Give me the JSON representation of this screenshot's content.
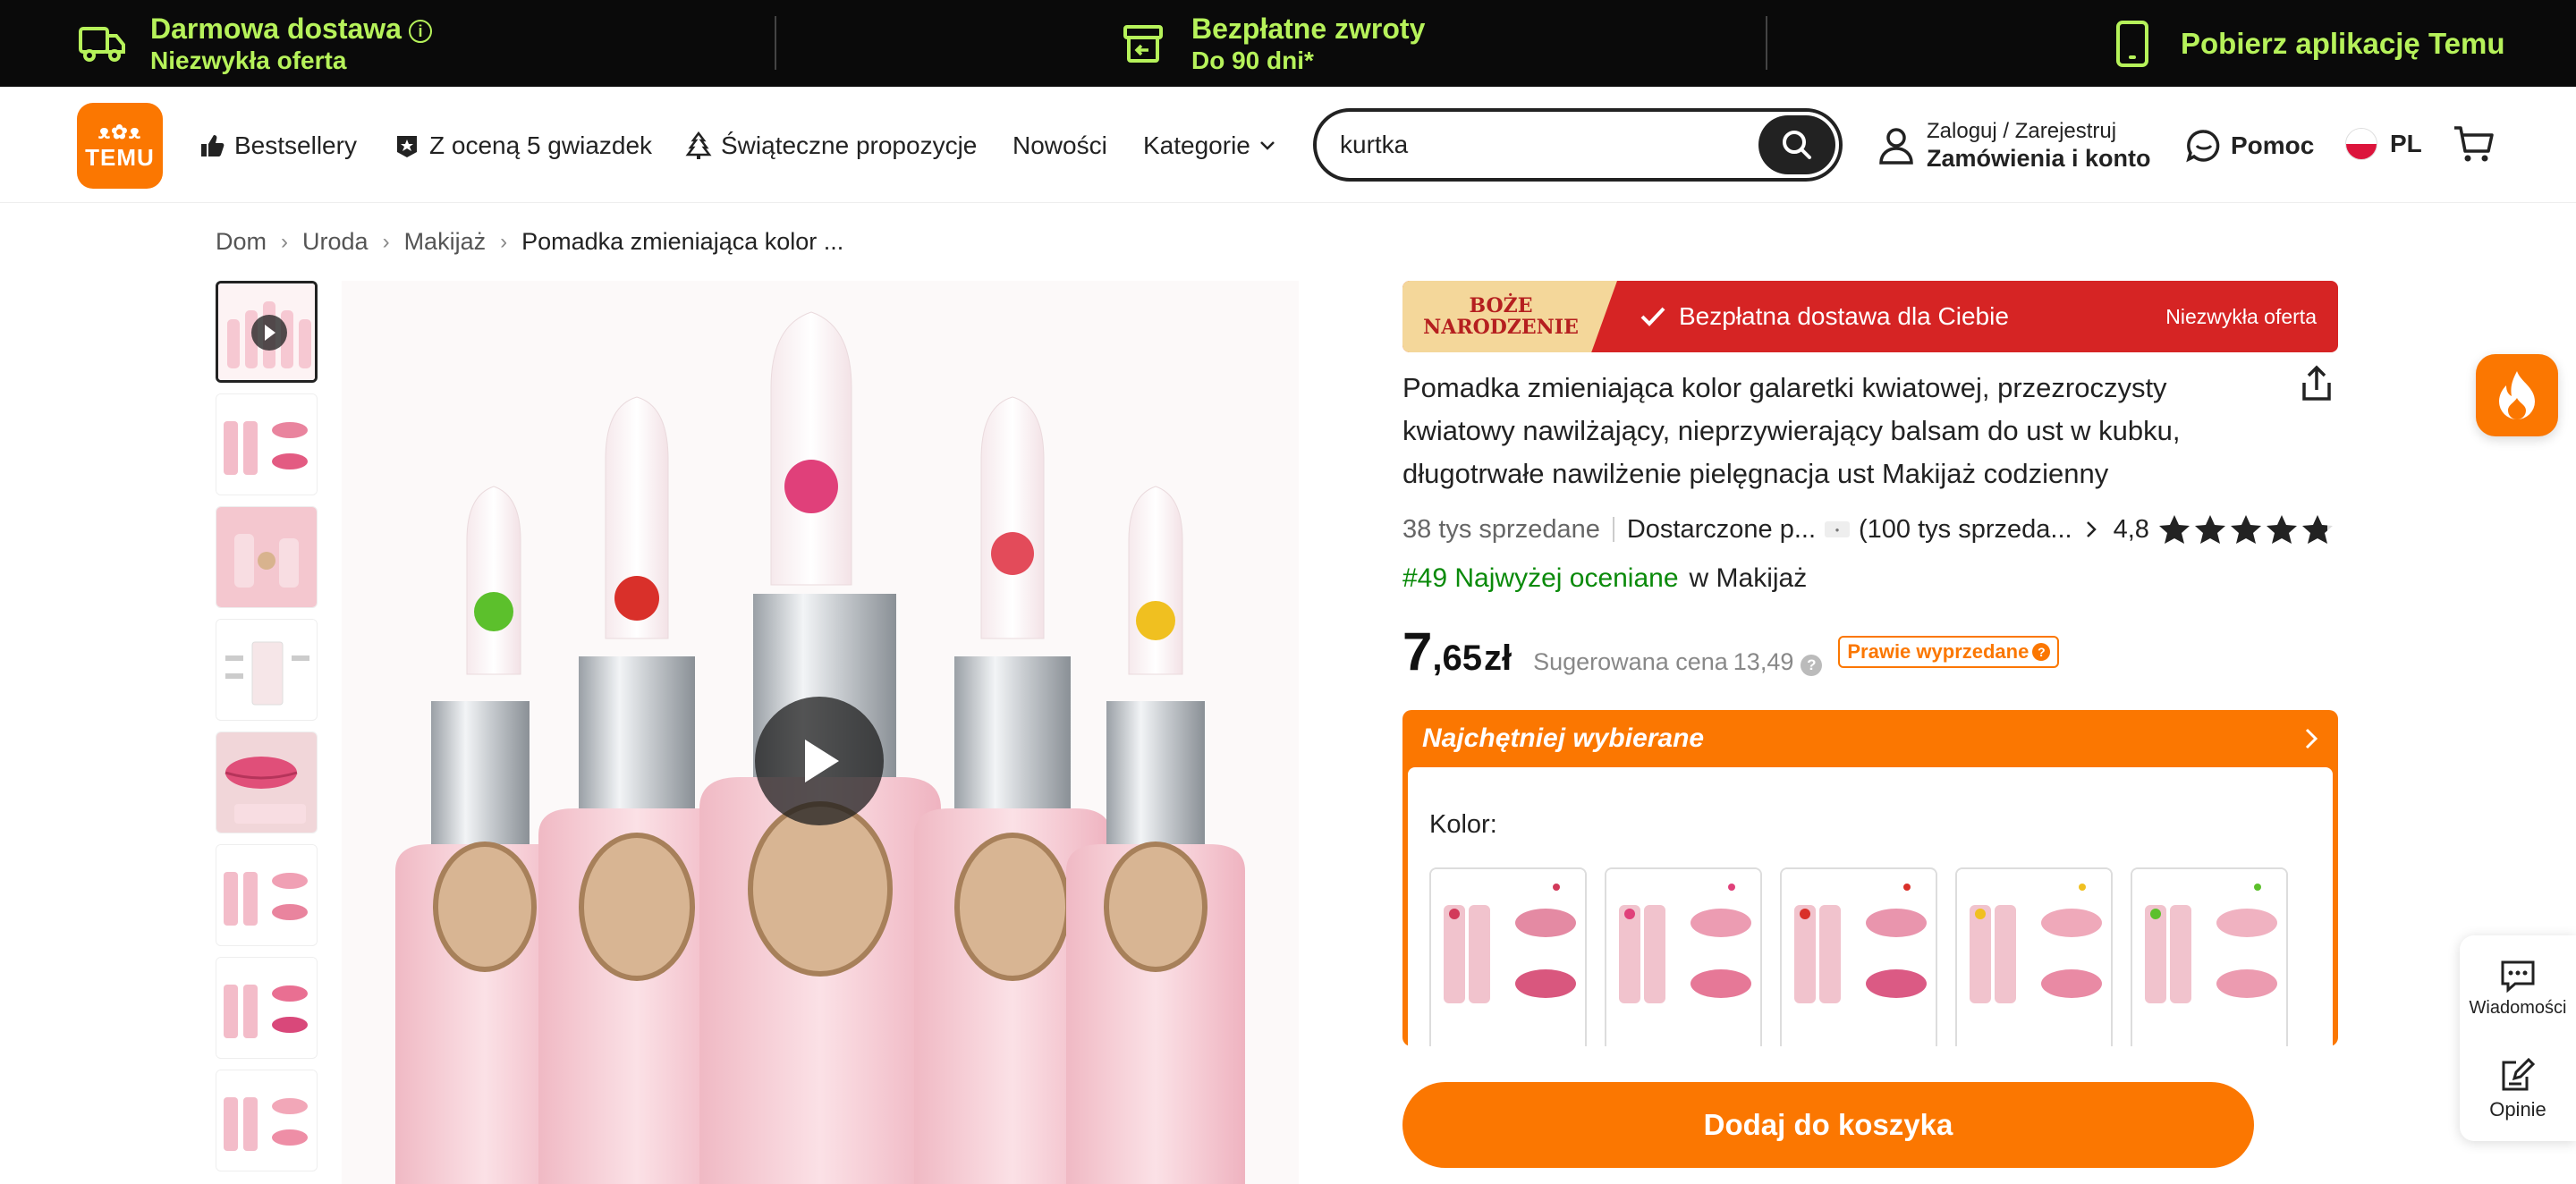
{
  "promo": {
    "shipping_title": "Darmowa dostawa",
    "shipping_sub": "Niezwykła oferta",
    "returns_title": "Bezpłatne zwroty",
    "returns_sub": "Do 90 dni*",
    "app": "Pobierz aplikację Temu"
  },
  "header": {
    "logo_top": "ᴥ✿ᴥ",
    "logo_text": "TEMU",
    "nav": {
      "bestsellers": "Bestsellery",
      "five_stars": "Z oceną 5 gwiazdek",
      "holiday": "Świąteczne propozycje",
      "new": "Nowości",
      "categories": "Kategorie"
    },
    "search_value": "kurtka",
    "account_line1": "Zaloguj / Zarejestruj",
    "account_line2": "Zamówienia i konto",
    "help": "Pomoc",
    "lang": "PL"
  },
  "breadcrumb": {
    "home": "Dom",
    "beauty": "Uroda",
    "makeup": "Makijaż",
    "current": "Pomadka zmieniająca kolor ..."
  },
  "product": {
    "xmas_badge_1": "BOŻE",
    "xmas_badge_2": "NARODZENIE",
    "free_delivery": "Bezpłatna dostawa dla Ciebie",
    "offer_note": "Niezwykła oferta",
    "title": "Pomadka zmieniająca kolor galaretki kwiatowej, przezroczysty kwiatowy nawilżający, nieprzywierający balsam do ust w kubku, długotrwałe nawilżenie pielęgnacja ust Makijaż codzienny",
    "sold": "38 tys sprzedane",
    "delivered_by": "Dostarczone p...",
    "store_sold": "(100 tys sprzeda...",
    "rating": "4,8",
    "rating_value": 4.8,
    "rank": "#49 Najwyżej oceniane",
    "rank_category": "w Makijaż",
    "price_int": "7",
    "price_dec": ",65",
    "price_currency": "zł",
    "suggested_label": "Sugerowana cena",
    "suggested_value": "13,49",
    "almost_sold_out": "Prawie wyprzedane",
    "choice_title": "Najchętniej wybierane",
    "color_label": "Kolor:",
    "add_to_cart": "Dodaj do koszyka"
  },
  "side": {
    "messages": "Wiadomości",
    "reviews": "Opinie"
  },
  "colors": {
    "accent": "#fb7701",
    "promo_green": "#b6f25a",
    "xmas_red": "#d62424",
    "rank_green": "#0a8a0a"
  }
}
